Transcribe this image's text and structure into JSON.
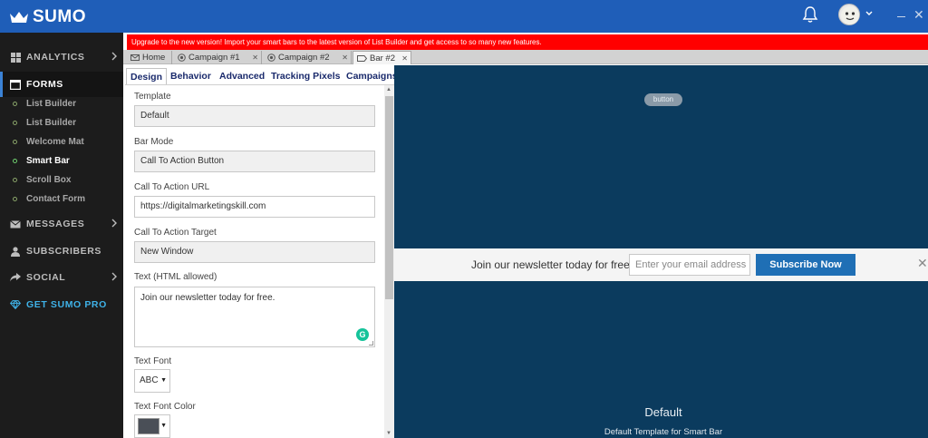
{
  "app": {
    "name": "SUMO"
  },
  "header": {
    "notifications_icon": "bell-icon",
    "avatar_icon": "user-avatar-icon"
  },
  "sidebar": {
    "analytics": "ANALYTICS",
    "forms": "FORMS",
    "form_items": [
      "List Builder",
      "List Builder",
      "Welcome Mat",
      "Smart Bar",
      "Scroll Box",
      "Contact Form"
    ],
    "messages": "MESSAGES",
    "subscribers": "SUBSCRIBERS",
    "social": "SOCIAL",
    "get_pro": "GET SUMO PRO"
  },
  "banner": {
    "text": "Upgrade to the new version! Import your smart bars to the latest version of List Builder and get access to so many new features."
  },
  "doc_tabs": [
    "Home",
    "Campaign #1",
    "Campaign #2",
    "Bar #2"
  ],
  "panel_tabs": [
    "Design",
    "Behavior",
    "Advanced",
    "Tracking Pixels",
    "Campaigns"
  ],
  "form": {
    "template_label": "Template",
    "template_value": "Default",
    "bar_mode_label": "Bar Mode",
    "bar_mode_value": "Call To Action Button",
    "cta_url_label": "Call To Action URL",
    "cta_url_value": "https://digitalmarketingskill.com",
    "cta_target_label": "Call To Action Target",
    "cta_target_value": "New Window",
    "text_label": "Text (HTML allowed)",
    "text_value": "Join our newsletter today for free.",
    "text_font_label": "Text Font",
    "text_font_value": "ABC",
    "text_font_color_label": "Text Font Color",
    "text_font_color": "#4a4f57"
  },
  "preview": {
    "button_label": "button",
    "bar_text": "Join our newsletter today for free.",
    "email_placeholder": "Enter your email address",
    "subscribe_label": "Subscribe Now",
    "template_name": "Default",
    "template_description": "Default Template for Smart Bar"
  },
  "colors": {
    "header_blue": "#1f5eb8",
    "banner_red": "#ff0000",
    "preview_bg": "#0b3b5e",
    "subscribe_blue": "#1f6fb5"
  }
}
